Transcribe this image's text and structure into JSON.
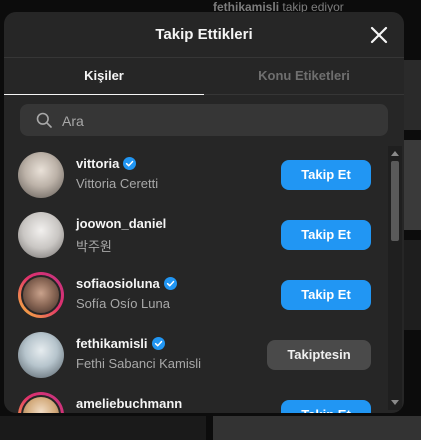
{
  "background": {
    "username": "fethikamisli",
    "notice": "takip ediyor"
  },
  "modal": {
    "title": "Takip Ettikleri",
    "close_icon": "close-icon",
    "tabs": [
      {
        "label": "Kişiler",
        "active": true
      },
      {
        "label": "Konu Etiketleri",
        "active": false
      }
    ],
    "search": {
      "placeholder": "Ara",
      "value": ""
    },
    "accounts": [
      {
        "username": "vittoria",
        "full_name": "Vittoria Ceretti",
        "verified": true,
        "action": "Takip Et",
        "story_ring": false
      },
      {
        "username": "joowon_daniel",
        "full_name": "박주원",
        "verified": false,
        "action": "Takip Et",
        "story_ring": false
      },
      {
        "username": "sofiaosioluna",
        "full_name": "Sofía Osío Luna",
        "verified": true,
        "action": "Takip Et",
        "story_ring": true
      },
      {
        "username": "fethikamisli",
        "full_name": "Fethi Sabanci Kamisli",
        "verified": true,
        "action": "Takiptesin",
        "story_ring": false
      },
      {
        "username": "ameliebuchmann",
        "full_name": "",
        "verified": false,
        "action": "Takip Et",
        "story_ring": true
      }
    ]
  },
  "colors": {
    "modal_bg": "#262626",
    "follow_button": "#2196f3",
    "following_button": "#4a4a4a",
    "verified_badge": "#2196f3"
  }
}
